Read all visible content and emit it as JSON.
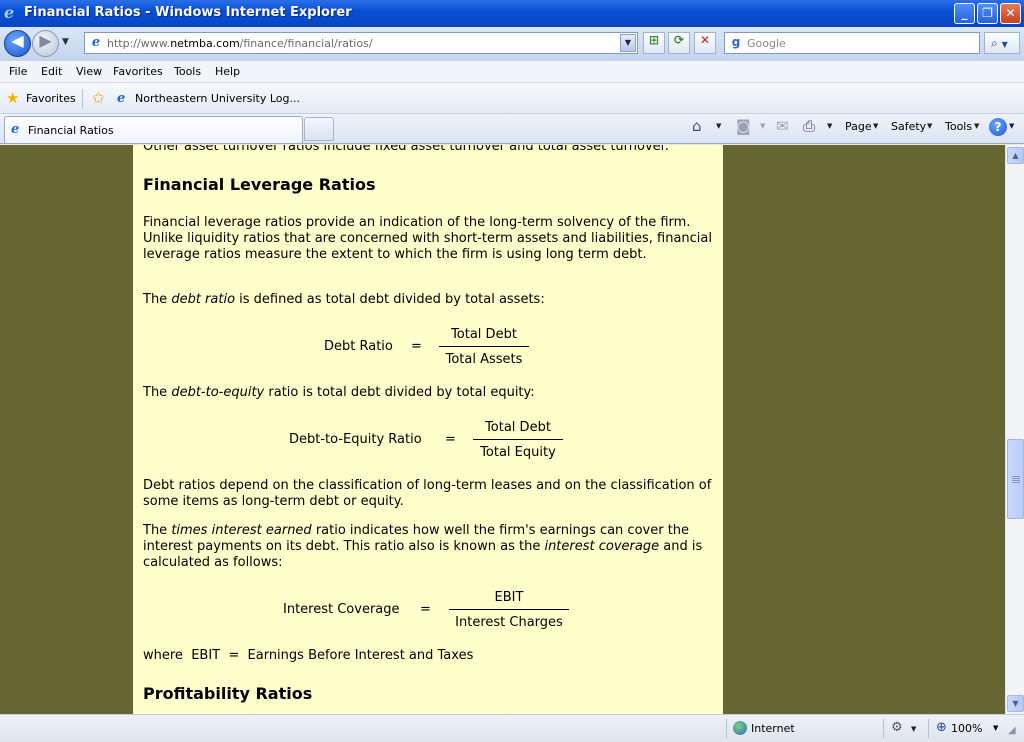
{
  "window": {
    "title": "Financial Ratios - Windows Internet Explorer",
    "minimize_icon": "minimize-icon",
    "maximize_icon": "restore-icon",
    "close_icon": "close-icon"
  },
  "address_bar": {
    "url_prefix": "http://www.",
    "url_domain": "netmba.com",
    "url_path": "/finance/financial/ratios/"
  },
  "search": {
    "placeholder": "Google"
  },
  "menu": {
    "items": [
      "File",
      "Edit",
      "View",
      "Favorites",
      "Tools",
      "Help"
    ]
  },
  "favorites_bar": {
    "favorites_label": "Favorites",
    "link_label": "Northeastern University Log..."
  },
  "tabs": [
    {
      "label": "Financial Ratios"
    }
  ],
  "command_bar": {
    "page_label": "Page",
    "safety_label": "Safety",
    "tools_label": "Tools"
  },
  "article": {
    "cut_off_line": "Other asset turnover ratios include fixed asset turnover and total asset turnover.",
    "heading_leverage": "Financial Leverage Ratios",
    "intro": "Financial leverage ratios provide an indication of the long-term solvency of the firm. Unlike liquidity ratios that are concerned with short-term assets and liabilities, financial leverage ratios measure the extent to which the firm is using long term debt.",
    "debt_ratio_sentence": {
      "before": "The ",
      "term": "debt ratio",
      "after": " is defined as total debt divided by total assets:"
    },
    "formula_debt_ratio": {
      "lhs": "Debt Ratio",
      "eq": "=",
      "numerator": "Total Debt",
      "denominator": "Total Assets"
    },
    "debt_equity_sentence": {
      "before": "The ",
      "term": "debt-to-equity",
      "after": " ratio is total debt divided by total equity:"
    },
    "formula_debt_equity": {
      "lhs": "Debt-to-Equity Ratio",
      "eq": "=",
      "numerator": "Total Debt",
      "denominator": "Total Equity"
    },
    "debt_ratios_paragraph": "Debt ratios depend on the classification of long-term leases and on the classification of some items as long-term debt or equity.",
    "tie_paragraph": {
      "p1": "The ",
      "term1": "times interest earned",
      "p2": " ratio indicates how well the firm's earnings can cover the interest payments on its debt. This ratio also is known as the ",
      "term2": "interest coverage",
      "p3": " and is calculated as follows:"
    },
    "formula_interest_coverage": {
      "lhs": "Interest Coverage",
      "eq": "=",
      "numerator": "EBIT",
      "denominator": "Interest Charges"
    },
    "where_line": "where  EBIT  =  Earnings Before Interest and Taxes",
    "heading_profitability": "Profitability Ratios"
  },
  "status_bar": {
    "zone_label": "Internet",
    "zoom_label": "100%"
  }
}
